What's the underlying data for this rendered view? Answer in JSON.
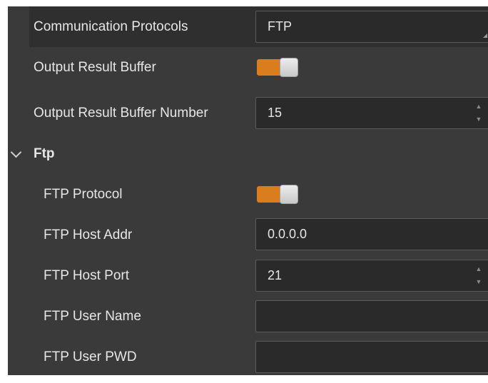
{
  "rows": [
    {
      "label": "Communication Protocols",
      "value": "FTP"
    },
    {
      "label": "Output Result Buffer",
      "toggle_on": true
    },
    {
      "label": "Output Result Buffer Number",
      "value": "15"
    }
  ],
  "section": {
    "label": "Ftp",
    "expanded": true
  },
  "ftp_rows": [
    {
      "label": "FTP Protocol",
      "toggle_on": true
    },
    {
      "label": "FTP Host Addr",
      "value": "0.0.0.0"
    },
    {
      "label": "FTP Host Port",
      "value": "21"
    },
    {
      "label": "FTP User Name",
      "value": ""
    },
    {
      "label": "FTP User PWD",
      "value": ""
    }
  ],
  "colors": {
    "panel_bg": "#3a3a3a",
    "highlight_bg": "#2f2f2f",
    "field_bg": "#2a2a2a",
    "toggle_on": "#d97d1f",
    "text": "#e6e6e6"
  },
  "icons": {
    "spinner_up": "▲",
    "spinner_down": "▼",
    "section_chevron": "chevron-down-icon"
  }
}
